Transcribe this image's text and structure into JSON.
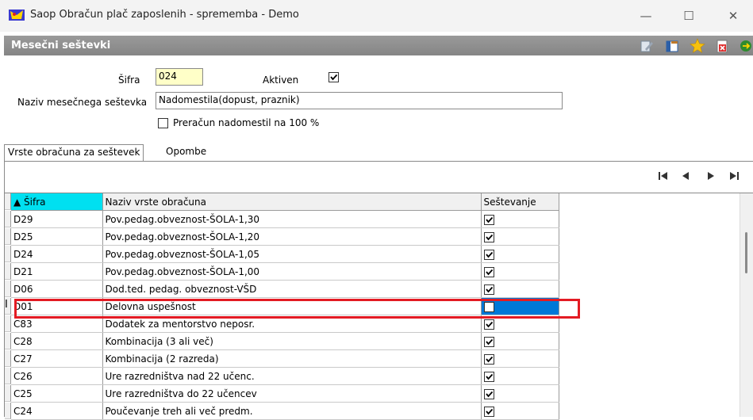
{
  "window": {
    "title": "Saop Obračun plač zaposlenih - sprememba - Demo",
    "controls": {
      "minimize": "—",
      "maximize": "☐",
      "close": "✕"
    }
  },
  "panel": {
    "title": "Mesečni seštevki",
    "toolbar_icons": [
      "edit-icon",
      "layout-icon",
      "star-icon",
      "delete-document-icon",
      "exit-icon"
    ]
  },
  "form": {
    "sifra_label": "Šifra",
    "sifra_value": "024",
    "aktiven_label": "Aktiven",
    "aktiven_checked": true,
    "naziv_label": "Naziv mesečnega seštevka",
    "naziv_value": "Nadomestila(dopust, praznik)",
    "preracun_label": "Preračun nadomestil na 100 %",
    "preracun_checked": false
  },
  "tabs": [
    {
      "label": "Vrste obračuna za seštevek",
      "active": true
    },
    {
      "label": "Opombe",
      "active": false
    }
  ],
  "navigator": [
    "first-record-icon",
    "previous-record-icon",
    "next-record-icon",
    "last-record-icon"
  ],
  "grid": {
    "columns": [
      {
        "key": "sifra",
        "label": "Šifra",
        "sorted": "asc"
      },
      {
        "key": "naziv",
        "label": "Naziv vrste obračuna"
      },
      {
        "key": "sestevanje",
        "label": "Seštevanje"
      }
    ],
    "rows": [
      {
        "sifra": "D29",
        "naziv": "Pov.pedag.obveznost-ŠOLA-1,30",
        "sestevanje": true
      },
      {
        "sifra": "D25",
        "naziv": "Pov.pedag.obveznost-ŠOLA-1,20",
        "sestevanje": true
      },
      {
        "sifra": "D24",
        "naziv": "Pov.pedag.obveznost-ŠOLA-1,05",
        "sestevanje": true
      },
      {
        "sifra": "D21",
        "naziv": "Pov.pedag.obveznost-ŠOLA-1,00",
        "sestevanje": true
      },
      {
        "sifra": "D06",
        "naziv": "Dod.ted. pedag. obveznost-VŠD",
        "sestevanje": true
      },
      {
        "sifra": "D01",
        "naziv": "Delovna uspešnost",
        "sestevanje": false,
        "selected": true
      },
      {
        "sifra": "C83",
        "naziv": "Dodatek za mentorstvo neposr.",
        "sestevanje": true
      },
      {
        "sifra": "C28",
        "naziv": "Kombinacija (3 ali več)",
        "sestevanje": true
      },
      {
        "sifra": "C27",
        "naziv": "Kombinacija (2 razreda)",
        "sestevanje": true
      },
      {
        "sifra": "C26",
        "naziv": "Ure razredništva nad 22 učenc.",
        "sestevanje": true
      },
      {
        "sifra": "C25",
        "naziv": "Ure razredništva do 22 učencev",
        "sestevanje": true
      },
      {
        "sifra": "C24",
        "naziv": "Poučevanje treh ali več predm.",
        "sestevanje": true
      }
    ]
  },
  "colors": {
    "selection": "#0078d7",
    "sort_header": "#00e0f0",
    "highlight": "#e31b23",
    "field_yellow": "#ffffc8"
  }
}
